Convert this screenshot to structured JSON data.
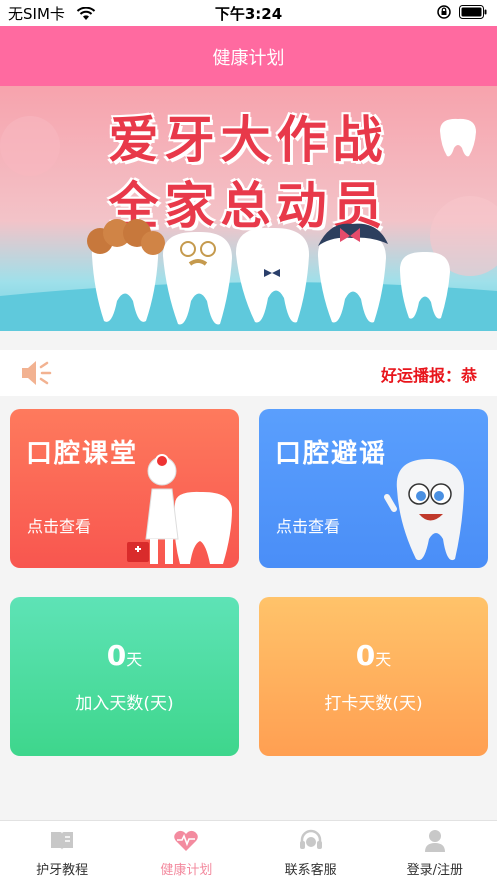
{
  "status_bar": {
    "carrier": "无SIM卡",
    "time": "下午3:24"
  },
  "nav": {
    "title": "健康计划"
  },
  "banner": {
    "line1": "爱牙大作战",
    "line2": "全家总动员"
  },
  "broadcast": {
    "label": "好运播报：恭"
  },
  "cards": {
    "ketang": {
      "title": "口腔课堂",
      "action": "点击查看"
    },
    "piyao": {
      "title": "口腔避谣",
      "action": "点击查看"
    }
  },
  "stats": {
    "join": {
      "value": "0",
      "unit": "天",
      "label": "加入天数(天)"
    },
    "checkin": {
      "value": "0",
      "unit": "天",
      "label": "打卡天数(天)"
    }
  },
  "tabs": [
    {
      "label": "护牙教程",
      "icon": "book-icon",
      "active": false
    },
    {
      "label": "健康计划",
      "icon": "heart-pulse-icon",
      "active": true
    },
    {
      "label": "联系客服",
      "icon": "headset-icon",
      "active": false
    },
    {
      "label": "登录/注册",
      "icon": "user-icon",
      "active": false
    }
  ],
  "colors": {
    "nav": "#ff6aa0",
    "broadcast_text": "#e8151c",
    "tab_active": "#f38b9f"
  }
}
